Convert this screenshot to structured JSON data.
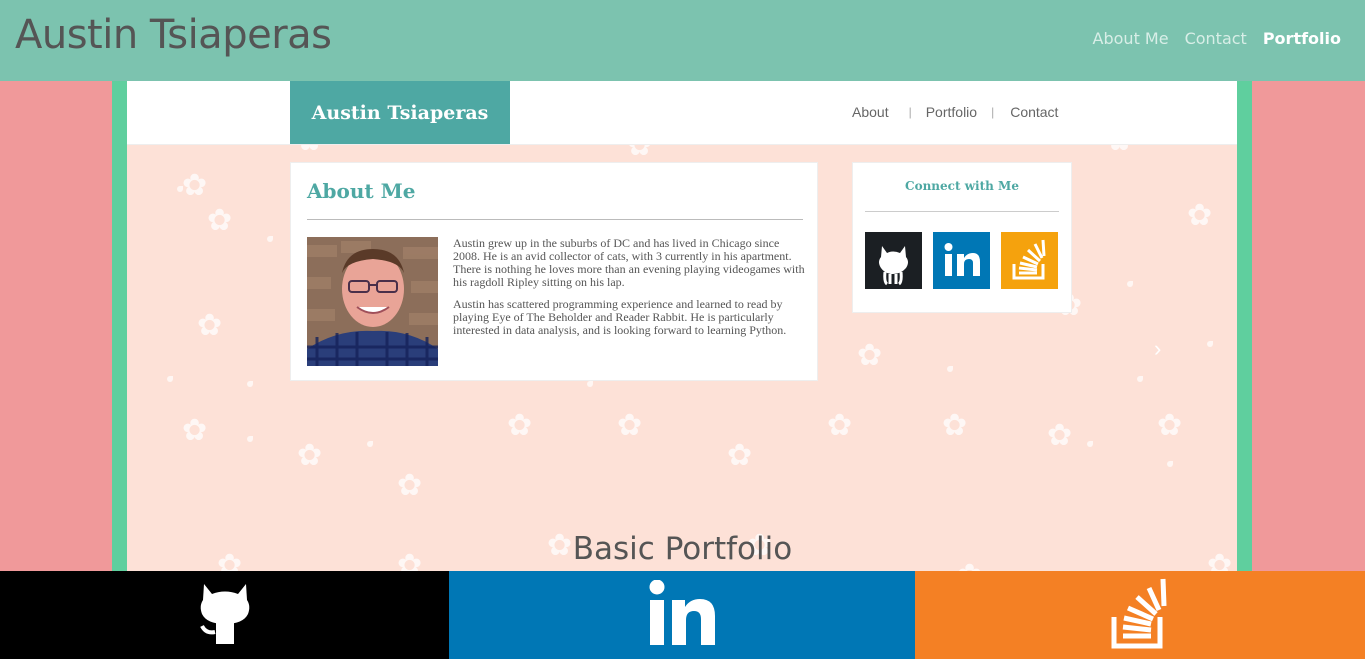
{
  "header": {
    "brand": "Austin Tsiaperas",
    "nav": [
      {
        "label": "About Me",
        "active": false
      },
      {
        "label": "Contact",
        "active": false
      },
      {
        "label": "Portfolio",
        "active": true
      }
    ]
  },
  "preview": {
    "brand": "Austin Tsiaperas",
    "nav": [
      "About",
      "Portfolio",
      "Contact"
    ],
    "about": {
      "title": "About Me",
      "paragraphs": [
        "Austin grew up in the suburbs of DC and has lived in Chicago since 2008. He is an avid collector of cats, with 3 currently in his apartment. There is nothing he loves more than an evening playing videogames with his ragdoll Ripley sitting on his lap.",
        "Austin has scattered programming experience and learned to read by playing Eye of The Beholder and Reader Rabbit. He is particularly interested in data analysis, and is looking forward to learning Python."
      ]
    },
    "connect": {
      "title": "Connect with Me",
      "icons": [
        "github-icon",
        "linkedin-icon",
        "stackoverflow-icon"
      ]
    },
    "carousel_next": "›"
  },
  "portfolio": {
    "title": "Basic Portfolio"
  },
  "social_bar": {
    "items": [
      "github-icon",
      "linkedin-icon",
      "stackoverflow-icon"
    ]
  },
  "colors": {
    "topbar": "#7cc3af",
    "page_bg": "#f0999a",
    "frame": "#5fcf9e",
    "accent": "#4ea8a3",
    "github": "#000000",
    "linkedin": "#0077b5",
    "stackoverflow": "#f48024"
  }
}
